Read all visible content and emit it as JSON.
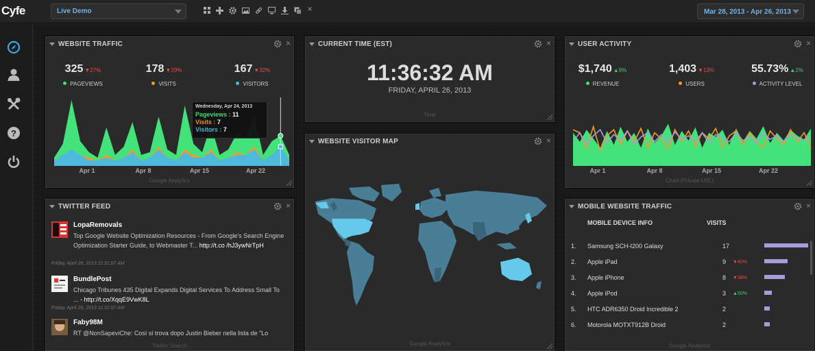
{
  "app": {
    "logo": "Cyfe"
  },
  "topbar": {
    "dashboard_select": "Live Demo",
    "date_range": "Mar 28, 2013 - Apr 26, 2013",
    "toolbar_icons": [
      "grid-icon",
      "plus-icon",
      "gear-icon",
      "image-icon",
      "link-icon",
      "monitor-icon",
      "download-icon",
      "copy-icon",
      "close-icon"
    ]
  },
  "sidebar": {
    "icons": [
      "compass-icon",
      "user-icon",
      "tools-icon",
      "help-icon",
      "power-icon"
    ]
  },
  "colors": {
    "green": "#44e27a",
    "blue": "#4fb9dc",
    "orange": "#f39a2c",
    "purple": "#a89bdc",
    "up": "#3fcf6f",
    "down": "#e84b4b"
  },
  "website_traffic": {
    "title": "WEBSITE TRAFFIC",
    "stats": [
      {
        "value": "325",
        "change": "▼27%",
        "label": "PAGEVIEWS",
        "color": "#44e27a"
      },
      {
        "value": "178",
        "change": "▼29%",
        "label": "VISITS",
        "color": "#f39a2c"
      },
      {
        "value": "167",
        "change": "▼32%",
        "label": "VISITORS",
        "color": "#4fb9dc"
      }
    ],
    "tooltip": {
      "date": "Wednesday, Apr 24, 2013",
      "rows": [
        {
          "label": "Pageviews",
          "value": "11"
        },
        {
          "label": "Visits",
          "value": "7"
        },
        {
          "label": "Visitors",
          "value": "7"
        }
      ]
    },
    "footer": "Google Analytics"
  },
  "current_time": {
    "title": "CURRENT TIME (EST)",
    "time": "11:36:32 AM",
    "date": "FRIDAY, APRIL 26, 2013",
    "footer": "Time"
  },
  "visitor_map": {
    "title": "WEBSITE VISITOR MAP",
    "footer": "Google Analytics"
  },
  "user_activity": {
    "title": "USER ACTIVITY",
    "stats": [
      {
        "value": "$1,740",
        "change": "▲9%",
        "dir": "up",
        "label": "REVENUE",
        "color": "#44e27a"
      },
      {
        "value": "1,403",
        "change": "▼13%",
        "dir": "down",
        "label": "USERS",
        "color": "#f39a2c"
      },
      {
        "value": "55.73%",
        "change": "▲2%",
        "dir": "up",
        "label": "ACTIVITY LEVEL",
        "color": "#a89bdc"
      }
    ],
    "footer": "Chart (Private URL)"
  },
  "twitter_feed": {
    "title": "TWITTER FEED",
    "tweets": [
      {
        "name": "LopaRemovals",
        "text": "Top Google Website Optimization Resources - From Google's Search Engine Optimization Starter Guide, to Webmaster T...",
        "link": "http://t.co /hJ3ywNrTpH",
        "time": "Friday, April 26, 2013 11:31:07 AM"
      },
      {
        "name": "BundlePost",
        "text": "Chicago Tribunes 435 Digital Expands Digital Services To Address Small To ...",
        "link": "- http://t.co/XqqE9VwK8L",
        "time": "Friday, April 26, 2013 11:31:07 AM"
      },
      {
        "name": "Faby98M",
        "text": "RT @NonSapeviChe: Così si trova dopo Justin Bieber nella lista de \"Lo",
        "link": "",
        "time": ""
      }
    ],
    "footer": "Twitter Search"
  },
  "mobile_traffic": {
    "title": "MOBILE WEBSITE TRAFFIC",
    "headers": {
      "device": "MOBILE DEVICE INFO",
      "visits": "VISITS"
    },
    "rows": [
      {
        "rank": "1.",
        "device": "Samsung SCH-I200 Galaxy",
        "visits": "17",
        "change": "",
        "dir": ""
      },
      {
        "rank": "2.",
        "device": "Apple iPad",
        "visits": "9",
        "change": "▼40%",
        "dir": "down"
      },
      {
        "rank": "3.",
        "device": "Apple iPhone",
        "visits": "8",
        "change": "▼38%",
        "dir": "down"
      },
      {
        "rank": "4.",
        "device": "Apple iPod",
        "visits": "3",
        "change": "▲50%",
        "dir": "up"
      },
      {
        "rank": "5.",
        "device": "HTC ADR6350 Droid Incredible 2",
        "visits": "2",
        "change": "",
        "dir": ""
      },
      {
        "rank": "6.",
        "device": "Motorola MOTXT912B Droid",
        "visits": "2",
        "change": "",
        "dir": ""
      }
    ],
    "footer": "Google Analytics"
  },
  "chart_data": [
    {
      "type": "area",
      "title": "WEBSITE TRAFFIC",
      "x_ticks": [
        "Apr 1",
        "Apr 8",
        "Apr 15",
        "Apr 22"
      ],
      "series": [
        {
          "name": "Pageviews",
          "color": "#44e27a",
          "values": [
            3,
            8,
            24,
            9,
            5,
            3,
            14,
            4,
            7,
            16,
            4,
            5,
            18,
            6,
            4,
            22,
            8,
            5,
            15,
            4,
            6,
            12,
            10,
            18,
            4,
            9,
            11,
            4
          ]
        },
        {
          "name": "Visits",
          "color": "#f39a2c",
          "values": [
            2,
            4,
            6,
            4,
            3,
            2,
            4,
            2,
            3,
            6,
            2,
            3,
            7,
            3,
            2,
            6,
            4,
            3,
            6,
            2,
            3,
            5,
            4,
            7,
            2,
            4,
            7,
            2
          ]
        },
        {
          "name": "Visitors",
          "color": "#4fb9dc",
          "values": [
            2,
            4,
            6,
            4,
            2,
            2,
            3,
            2,
            3,
            5,
            2,
            3,
            6,
            3,
            2,
            5,
            3,
            3,
            5,
            2,
            3,
            4,
            4,
            6,
            2,
            4,
            7,
            2
          ]
        }
      ]
    },
    {
      "type": "area",
      "title": "USER ACTIVITY",
      "x_ticks": [
        "Apr 1",
        "Apr 8",
        "Apr 15",
        "Apr 22"
      ],
      "series": [
        {
          "name": "Revenue",
          "color": "#44e27a",
          "values": [
            55,
            40,
            60,
            45,
            30,
            58,
            35,
            65,
            40,
            55,
            30,
            62,
            38,
            50,
            70,
            35,
            58,
            42,
            64,
            30,
            55,
            48,
            60,
            35,
            62,
            40,
            58,
            45,
            66,
            38,
            55,
            42,
            60,
            50,
            44,
            62
          ]
        },
        {
          "name": "Users",
          "color": "#f39a2c",
          "values": [
            60,
            55,
            30,
            65,
            25,
            50,
            60,
            35,
            58,
            40,
            62,
            30,
            55,
            45,
            28,
            60,
            40,
            58,
            32,
            55,
            45,
            62,
            30,
            50,
            58,
            35,
            55,
            40,
            30,
            58,
            45,
            35,
            60,
            40,
            55,
            30
          ]
        },
        {
          "name": "Activity Level",
          "color": "#a89bdc",
          "values": [
            40,
            55,
            35,
            50,
            60,
            38,
            52,
            42,
            58,
            35,
            48,
            55,
            40,
            52,
            38,
            56,
            44,
            50,
            40,
            55,
            38,
            52,
            46,
            40,
            55,
            42,
            48,
            38,
            54,
            44,
            50,
            40,
            52,
            46,
            42,
            50
          ]
        }
      ]
    }
  ]
}
